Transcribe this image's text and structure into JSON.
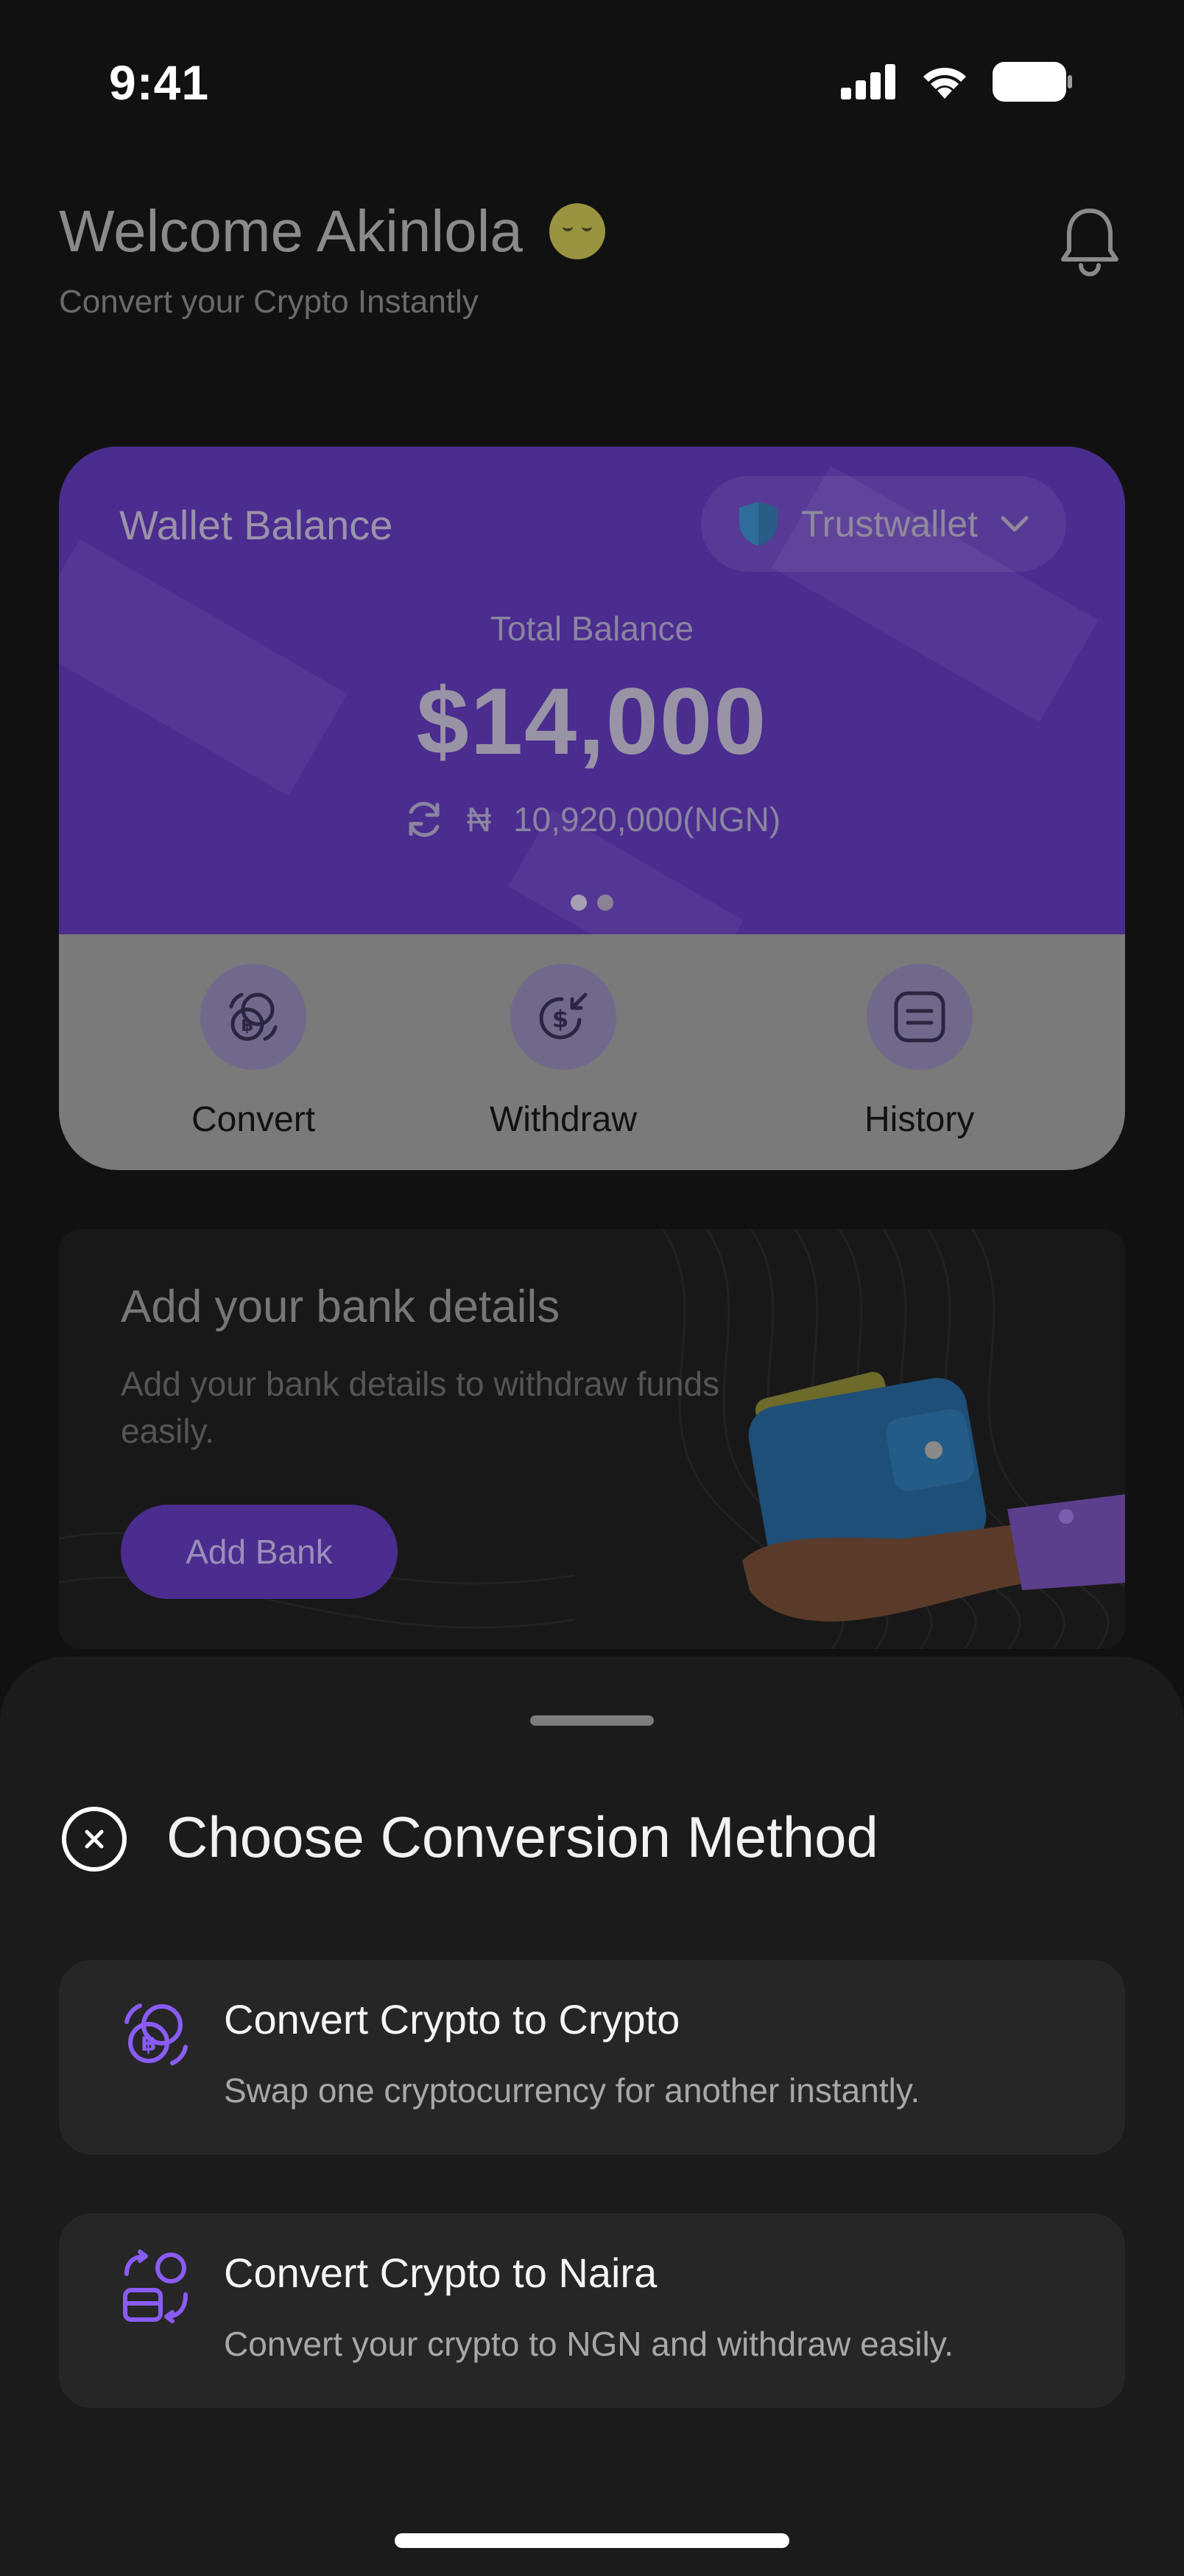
{
  "status_bar": {
    "time": "9:41"
  },
  "header": {
    "welcome": "Welcome Akinlola",
    "subtitle": "Convert your Crypto Instantly"
  },
  "wallet": {
    "label": "Wallet Balance",
    "selected_wallet": "Trustwallet",
    "total_label": "Total Balance",
    "total_value": "$14,000",
    "ngn_symbol": "₦",
    "ngn_value": "10,920,000(NGN)",
    "actions": [
      {
        "label": "Convert"
      },
      {
        "label": "Withdraw"
      },
      {
        "label": "History"
      }
    ]
  },
  "bank_card": {
    "title": "Add your bank details",
    "description": "Add your bank details to withdraw funds easily.",
    "button": "Add Bank"
  },
  "sheet": {
    "title": "Choose Conversion Method",
    "options": [
      {
        "title": "Convert Crypto to Crypto",
        "description": "Swap one cryptocurrency for another instantly.",
        "icon": "crypto-swap-icon"
      },
      {
        "title": "Convert Crypto to Naira",
        "description": "Convert your crypto to NGN and withdraw easily.",
        "icon": "crypto-to-fiat-icon"
      }
    ]
  },
  "colors": {
    "accent": "#7c4dff",
    "card_purple": "#4b2c8f",
    "sheet_bg": "#1b1b1b",
    "option_bg": "#262626"
  }
}
